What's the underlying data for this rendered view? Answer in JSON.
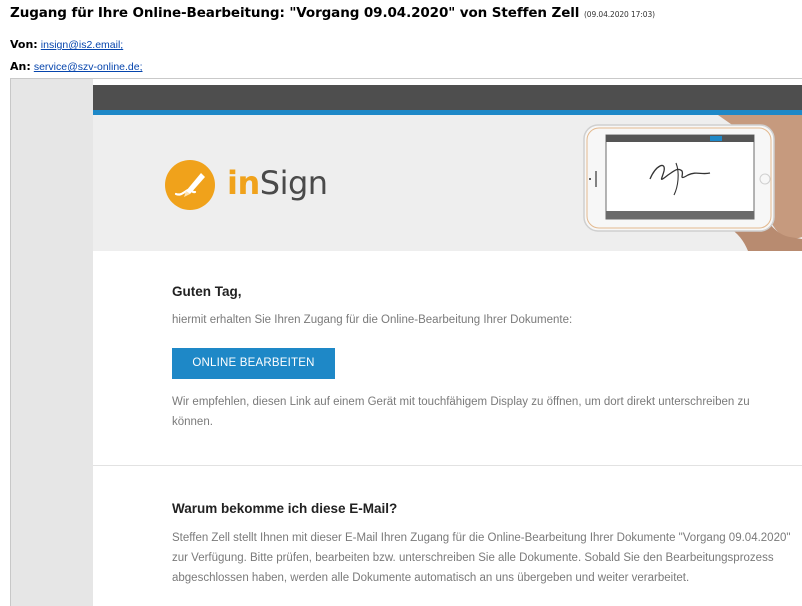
{
  "mail": {
    "subject": "Zugang für Ihre Online-Bearbeitung: \"Vorgang 09.04.2020\" von Steffen Zell",
    "date": "(09.04.2020 17:03)",
    "from_label": "Von:",
    "from_value": "insign@is2.email;",
    "to_label": "An:",
    "to_value": "service@szv-online.de;"
  },
  "banner": {
    "logo_prefix": "in",
    "logo_suffix": "Sign"
  },
  "content": {
    "greeting": "Guten Tag,",
    "intro": "hiermit erhalten Sie Ihren Zugang für die Online-Bearbeitung Ihrer Dokumente:",
    "button_label": "ONLINE BEARBEITEN",
    "recommendation": "Wir empfehlen, diesen Link auf einem Gerät mit touchfähigem Display zu öffnen, um dort direkt unterschreiben zu können.",
    "why_title": "Warum bekomme ich diese E-Mail?",
    "why_text": "Steffen Zell stellt Ihnen mit dieser E-Mail Ihren Zugang für die Online-Bearbeitung Ihrer Dokumente \"Vorgang 09.04.2020\" zur Verfügung. Bitte prüfen, bearbeiten bzw. unterschreiben Sie alle Dokumente. Sobald Sie den Bearbeitungsprozess abgeschlossen haben, werden alle Dokumente automatisch an uns übergeben und weiter verarbeitet."
  },
  "colors": {
    "accent_blue": "#1e88c7",
    "brand_orange": "#f0a21b",
    "dark_bar": "#4e4e4e"
  }
}
